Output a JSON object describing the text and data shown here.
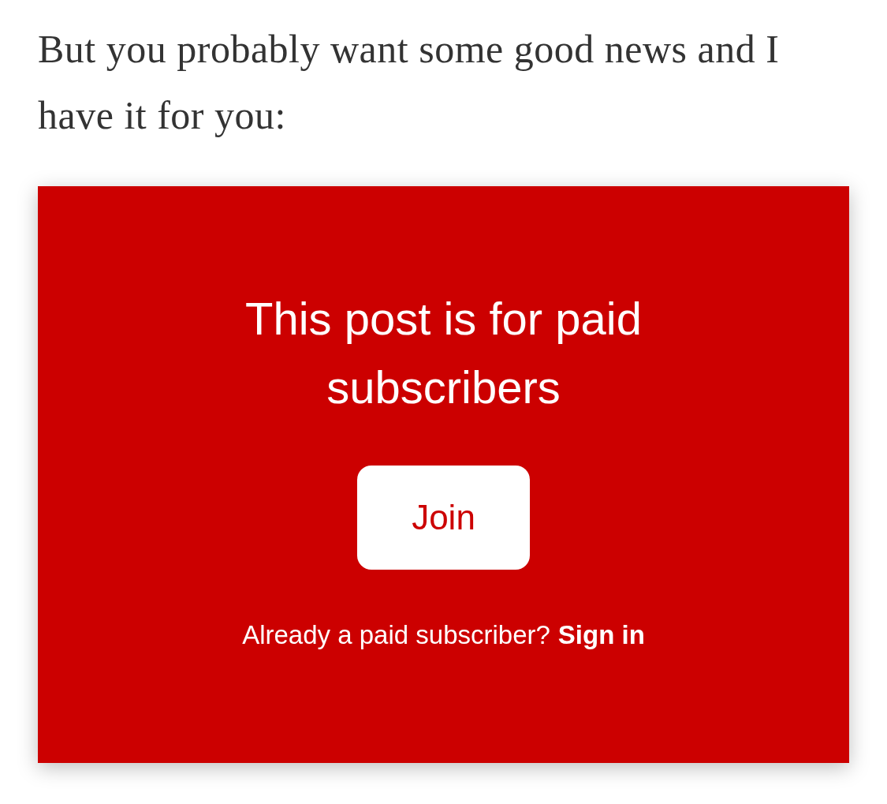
{
  "intro": "But you probably want some good news and I have it for you:",
  "paywall": {
    "heading": "This post is for paid subscribers",
    "button": "Join",
    "prompt": "Already a paid subscriber?",
    "link": "Sign in"
  }
}
